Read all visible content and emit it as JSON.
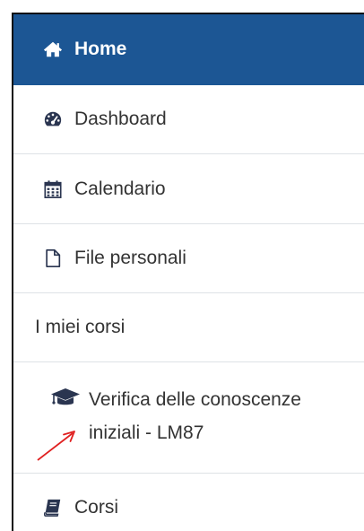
{
  "nav": {
    "home": {
      "label": "Home",
      "icon": "home-icon"
    },
    "dashboard": {
      "label": "Dashboard",
      "icon": "dashboard-icon"
    },
    "calendar": {
      "label": "Calendario",
      "icon": "calendar-icon"
    },
    "files": {
      "label": "File personali",
      "icon": "file-icon"
    },
    "my_courses": {
      "label": "I miei corsi"
    },
    "course": {
      "line1": "Verifica delle conoscenze",
      "line2": "iniziali - LM87",
      "icon": "graduation-cap-icon"
    },
    "courses": {
      "label": "Corsi",
      "icon": "book-icon"
    }
  },
  "colors": {
    "home_bg": "#1c5694",
    "text": "#333333",
    "divider": "#dee2e6",
    "annotation_arrow": "#e02020"
  }
}
